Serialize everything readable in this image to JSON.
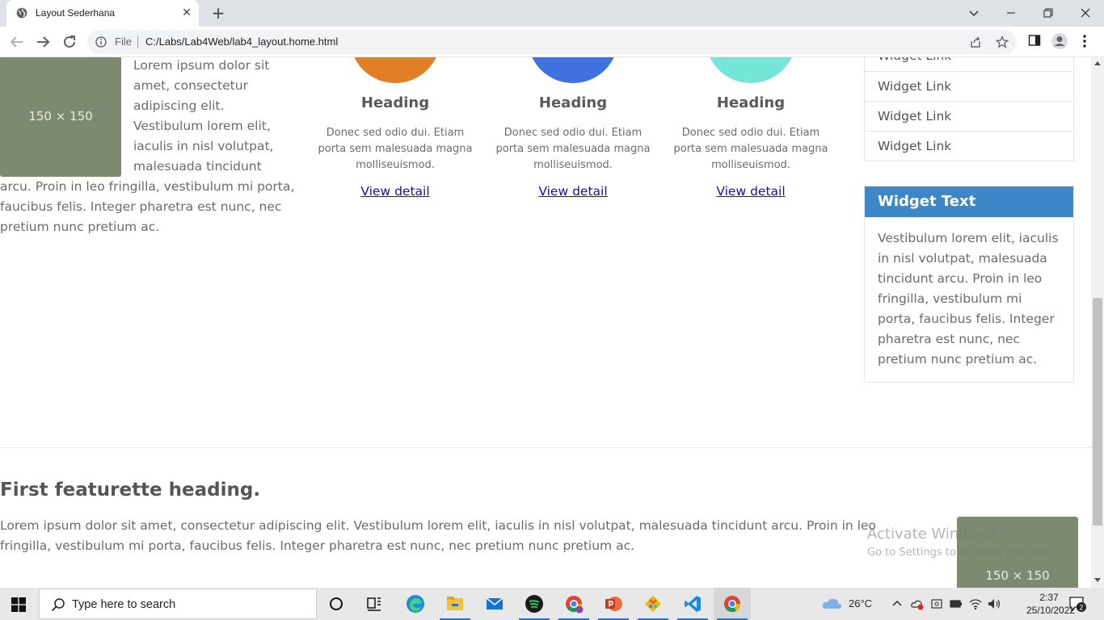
{
  "browser": {
    "tab_title": "Layout Sederhana",
    "file_label": "File",
    "url": "C:/Labs/Lab4Web/lab4_layout.home.html"
  },
  "intro": {
    "thumb_label": "150 × 150",
    "text": "Lorem ipsum dolor sit amet, consectetur adipiscing elit. Vestibulum lorem elit, iaculis in nisl volutpat, malesuada tincidunt arcu. Proin in leo fringilla, vestibulum mi porta, faucibus felis. Integer pharetra est nunc, nec pretium nunc pretium ac."
  },
  "features": [
    {
      "heading": "Heading",
      "text": "Donec sed odio dui. Etiam porta sem malesuada magna molliseuismod.",
      "link": "View detail",
      "color": "#e07f26"
    },
    {
      "heading": "Heading",
      "text": "Donec sed odio dui. Etiam porta sem malesuada magna molliseuismod.",
      "link": "View detail",
      "color": "#3f72e0"
    },
    {
      "heading": "Heading",
      "text": "Donec sed odio dui. Etiam porta sem malesuada magna molliseuismod.",
      "link": "View detail",
      "color": "#74e6d7"
    }
  ],
  "widget_links": [
    "Widget Link",
    "Widget Link",
    "Widget Link",
    "Widget Link"
  ],
  "widget_text": {
    "heading": "Widget Text",
    "body": "Vestibulum lorem elit, iaculis in nisl volutpat, malesuada tincidunt arcu. Proin in leo fringilla, vestibulum mi porta, faucibus felis. Integer pharetra est nunc, nec pretium nunc pretium ac.",
    "header_color": "#3d87c9"
  },
  "featurette": {
    "heading": "First featurette heading.",
    "text": "Lorem ipsum dolor sit amet, consectetur adipiscing elit. Vestibulum lorem elit, iaculis in nisl volutpat, malesuada tincidunt arcu. Proin in leo fringilla, vestibulum mi porta, faucibus felis. Integer pharetra est nunc, nec pretium nunc pretium ac.",
    "thumb_label": "150 × 150"
  },
  "watermark": {
    "title": "Activate Windows",
    "subtitle": "Go to Settings to activate Windows."
  },
  "taskbar": {
    "search_placeholder": "Type here to search",
    "temperature": "26°C",
    "time": "2:37",
    "date": "25/10/2022",
    "notification_count": "2",
    "apps": [
      "cortana-icon",
      "task-view-icon",
      "edge-icon",
      "file-explorer-icon",
      "mail-icon",
      "spotify-icon",
      "chrome-profile-icon",
      "powerpoint-icon",
      "git-icon",
      "vscode-icon",
      "chrome-icon"
    ]
  }
}
